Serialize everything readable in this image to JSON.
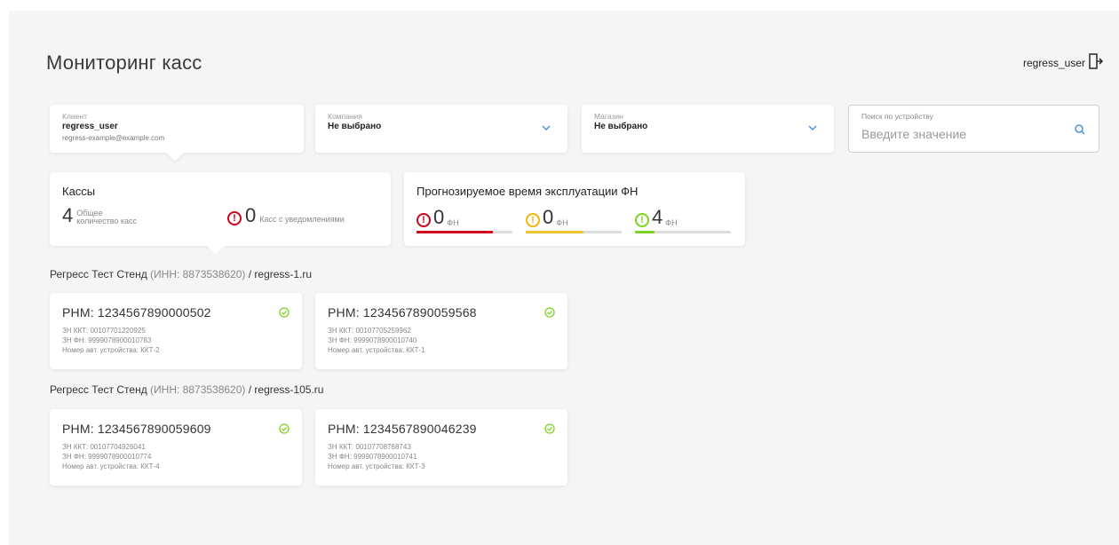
{
  "header": {
    "title": "Мониторинг касс",
    "user": "regress_user"
  },
  "filters": {
    "client": {
      "label": "Клиент",
      "value": "regress_user",
      "email": "regress-example@example.com"
    },
    "company": {
      "label": "Компания",
      "value": "Не выбрано"
    },
    "shop": {
      "label": "Магазин",
      "value": "Не выбрано"
    },
    "search": {
      "label": "Поиск по устройству",
      "placeholder": "Введите значение"
    }
  },
  "summary": {
    "kassy": {
      "title": "Кассы",
      "total": "4",
      "total_label_1": "Общее",
      "total_label_2": "количество касс",
      "notifications": "0",
      "notifications_label": "Касс с уведомлениями"
    },
    "fn": {
      "title": "Прогнозируемое время эксплуатации ФН",
      "groups": [
        {
          "value": "0",
          "unit": "ФН",
          "status": "red",
          "fill": 0.8
        },
        {
          "value": "0",
          "unit": "ФН",
          "status": "yellow",
          "fill": 0.6
        },
        {
          "value": "4",
          "unit": "ФН",
          "status": "green",
          "fill": 0.2
        }
      ]
    }
  },
  "groups": [
    {
      "name": "Регресс Тест Стенд",
      "inn": "(ИНН: 8873538620)",
      "domain": "/ regress-1.ru",
      "cards": [
        {
          "rnm": "РНМ: 1234567890000502",
          "zn_kkt": "ЗН ККТ: 00107701220925",
          "zn_fn": "ЗН ФН: 9999078900010783",
          "device": "Номер авт. устройства: ККТ-2"
        },
        {
          "rnm": "РНМ: 1234567890059568",
          "zn_kkt": "ЗН ККТ: 00107705259962",
          "zn_fn": "ЗН ФН: 9999078900010740",
          "device": "Номер авт. устройства: ККТ-1"
        }
      ]
    },
    {
      "name": "Регресс Тест Стенд",
      "inn": "(ИНН: 8873538620)",
      "domain": "/ regress-105.ru",
      "cards": [
        {
          "rnm": "РНМ: 1234567890059609",
          "zn_kkt": "ЗН ККТ: 00107704926041",
          "zn_fn": "ЗН ФН: 9999078900010774",
          "device": "Номер авт. устройства: ККТ-4"
        },
        {
          "rnm": "РНМ: 1234567890046239",
          "zn_kkt": "ЗН ККТ: 00107708768743",
          "zn_fn": "ЗН ФН: 9999078900010741",
          "device": "Номер авт. устройства: ККТ-3"
        }
      ]
    }
  ],
  "colors": {
    "red": "#d0021b",
    "yellow": "#f2c12e",
    "green": "#7ed321",
    "accent": "#4a90e2"
  }
}
